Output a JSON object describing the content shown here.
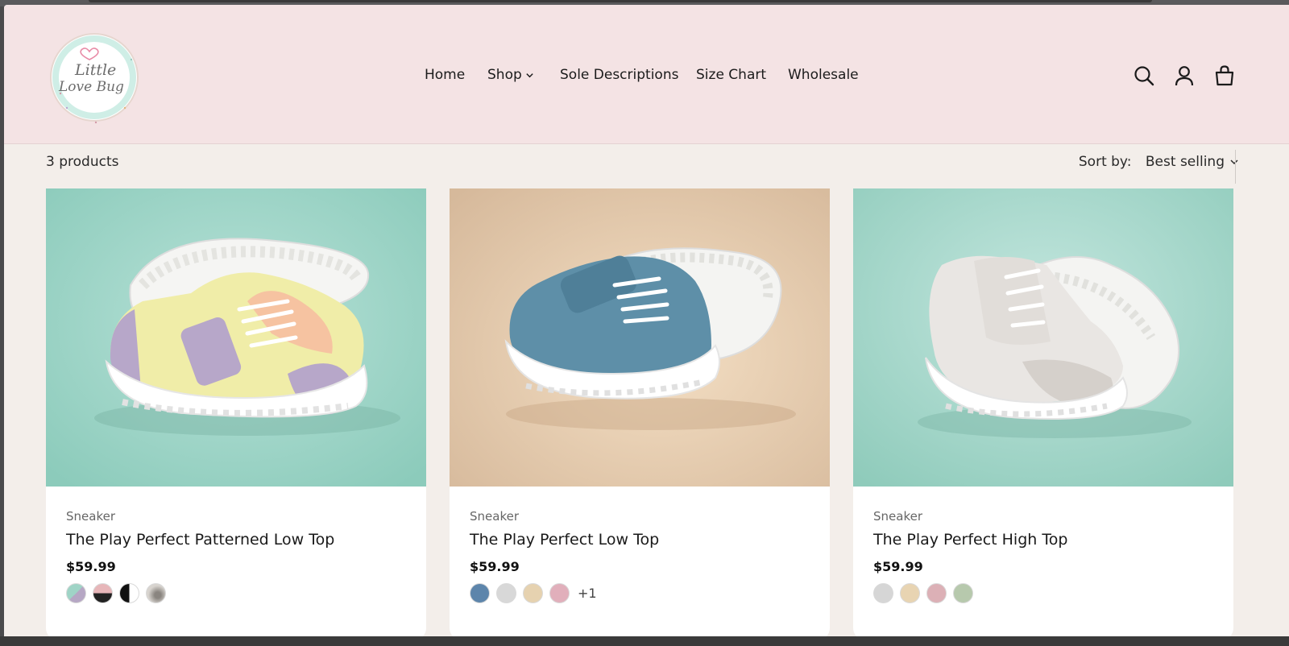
{
  "header": {
    "logo_text": [
      "Little",
      "Love Bug"
    ],
    "nav": [
      {
        "label": "Home"
      },
      {
        "label": "Shop"
      },
      {
        "label": "Sole Descriptions"
      },
      {
        "label": "Size Chart"
      },
      {
        "label": "Wholesale"
      }
    ],
    "icons": [
      "search-icon",
      "account-icon",
      "cart-icon"
    ]
  },
  "toolbar": {
    "count": "3 products",
    "sort_label": "Sort by:",
    "sort_value": "Best selling"
  },
  "products": [
    {
      "vendor": "Sneaker",
      "title": "The Play Perfect Patterned Low Top",
      "price": "$59.99",
      "swatches": [
        "#b6a7c4",
        "#e7b6b9",
        "#111111",
        "#c9c3bd"
      ]
    },
    {
      "vendor": "Sneaker",
      "title": "The Play Perfect Low Top",
      "price": "$59.99",
      "swatches": [
        "#5d85ab",
        "#d8d8d8",
        "#e6d2b0",
        "#e1afbb"
      ],
      "more": "+1"
    },
    {
      "vendor": "Sneaker",
      "title": "The Play Perfect High Top",
      "price": "$59.99",
      "swatches": [
        "#d6d6d6",
        "#e8d4b2",
        "#dcb0b6",
        "#b7c9ad"
      ]
    }
  ],
  "colors": {
    "header_bg": "#f4e3e4",
    "page_bg": "#f3eeea",
    "mint_bg": "#9fd4c6",
    "tan_bg": "#e3cdb2"
  }
}
